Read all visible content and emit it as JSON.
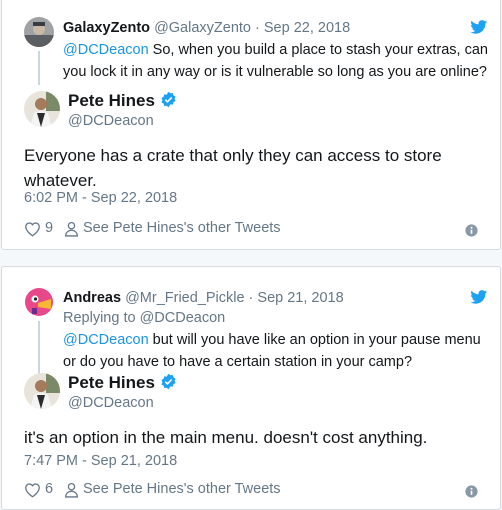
{
  "tweets": [
    {
      "parent": {
        "name": "GalaxyZento",
        "handle_date": "@GalaxyZento · Sep 22, 2018",
        "replying_to": "",
        "mention": "@DCDeacon",
        "text": " So, when you build a place to stash your extras, can you lock it in any way or is it vulnerable so long as you are online?"
      },
      "reply": {
        "name": "Pete Hines",
        "handle": "@DCDeacon",
        "text": "Everyone has a crate that only they can access to store whatever.",
        "time": "6:02 PM - Sep 22, 2018",
        "likes": "9",
        "other_tweets": "See Pete Hines's other Tweets"
      }
    },
    {
      "parent": {
        "name": "Andreas",
        "handle_date": "@Mr_Fried_Pickle · Sep 21, 2018",
        "replying_to": "Replying to @DCDeacon",
        "mention": "@DCDeacon",
        "text": " but will you have like an option in your pause menu or do you have to have a certain station in your camp?"
      },
      "reply": {
        "name": "Pete Hines",
        "handle": "@DCDeacon",
        "text": "it's an option in the main menu. doesn't cost anything.",
        "time": "7:47 PM - Sep 21, 2018",
        "likes": "6",
        "other_tweets": "See Pete Hines's other Tweets"
      }
    }
  ],
  "colors": {
    "link": "#1b95e0",
    "muted": "#657786",
    "text": "#14171a",
    "bird": "#1da1f2"
  },
  "icons": [
    "twitter-bird-icon",
    "verified-badge-icon",
    "heart-icon",
    "person-icon",
    "info-icon"
  ]
}
